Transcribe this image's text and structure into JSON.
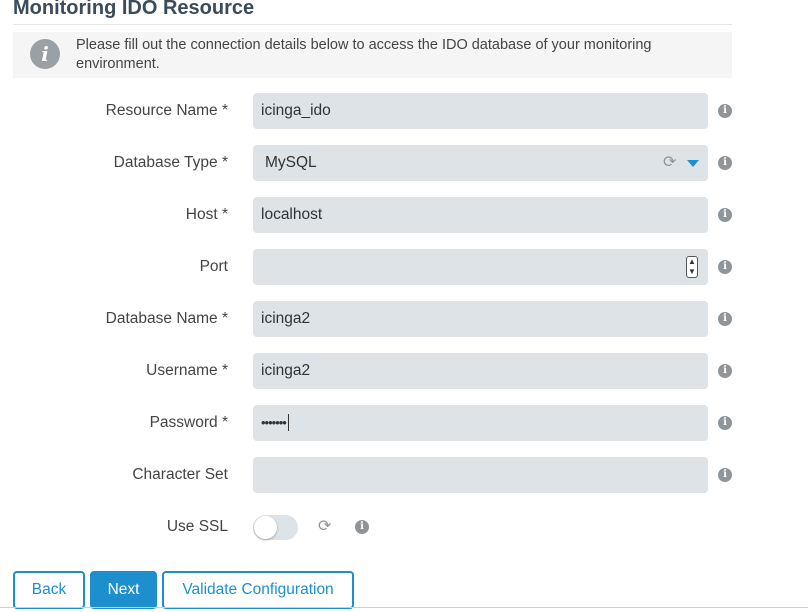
{
  "title": "Monitoring IDO Resource",
  "info": {
    "icon": "info-icon",
    "text": "Please fill out the connection details below to access the IDO database of your monitoring environment."
  },
  "fields": {
    "resource_name": {
      "label": "Resource Name *",
      "value": "icinga_ido"
    },
    "database_type": {
      "label": "Database Type *",
      "value": "MySQL"
    },
    "host": {
      "label": "Host *",
      "value": "localhost"
    },
    "port": {
      "label": "Port",
      "value": ""
    },
    "database_name": {
      "label": "Database Name *",
      "value": "icinga2"
    },
    "username": {
      "label": "Username *",
      "value": "icinga2"
    },
    "password": {
      "label": "Password *",
      "value": "•••••••"
    },
    "character_set": {
      "label": "Character Set",
      "value": ""
    },
    "use_ssl": {
      "label": "Use SSL",
      "enabled": false
    }
  },
  "buttons": {
    "back": "Back",
    "next": "Next",
    "validate": "Validate Configuration"
  },
  "colors": {
    "accent": "#1d8fcf",
    "field_bg": "#dde3e6",
    "title": "#3a4c5b"
  }
}
